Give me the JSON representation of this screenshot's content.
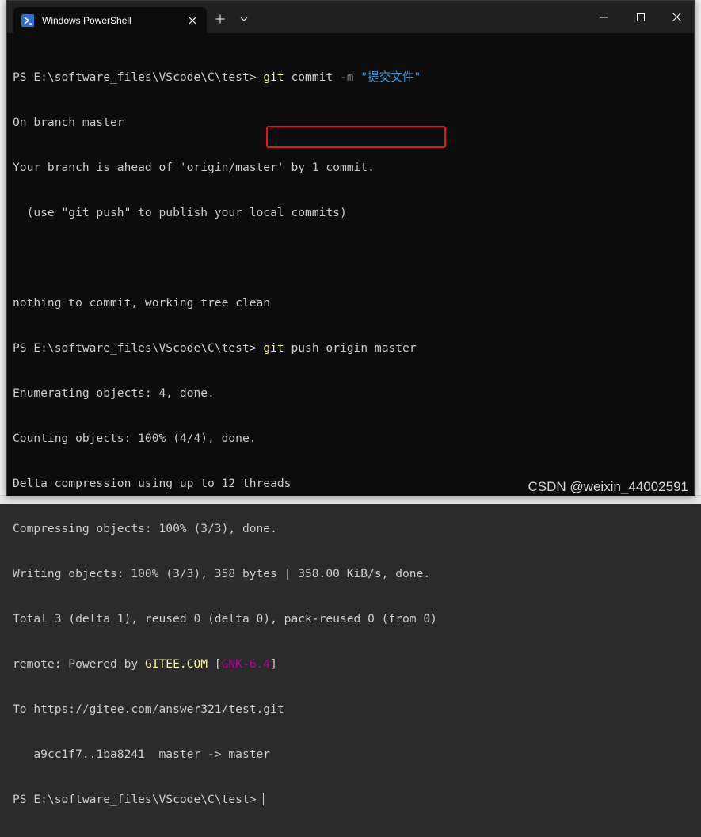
{
  "window": {
    "tab_title": "Windows PowerShell",
    "new_tab_symbol": "+",
    "icon": "powershell-icon"
  },
  "terminal": {
    "prompt": "PS E:\\software_files\\VScode\\C\\test>",
    "line1": {
      "cmd": "git",
      "mid": " commit ",
      "flag": "-m",
      "space": " ",
      "str": "\"提交文件\""
    },
    "line2": "On branch master",
    "line3": "Your branch is ahead of 'origin/master' by 1 commit.",
    "line4": "  (use \"git push\" to publish your local commits)",
    "line5": "",
    "line6": "nothing to commit, working tree clean",
    "line7": {
      "cmd": "git",
      "rest": " push origin master"
    },
    "line8": "Enumerating objects: 4, done.",
    "line9": "Counting objects: 100% (4/4), done.",
    "line10": "Delta compression using up to 12 threads",
    "line11": "Compressing objects: 100% (3/3), done.",
    "line12": "Writing objects: 100% (3/3), 358 bytes | 358.00 KiB/s, done.",
    "line13": "Total 3 (delta 1), reused 0 (delta 0), pack-reused 0 (from 0)",
    "line14": {
      "prefix": "remote: Powered by ",
      "gitee": "GITEE.COM",
      "open": " [",
      "gnk": "GNK-6.4",
      "close": "]"
    },
    "line15": "To https://gitee.com/answer321/test.git",
    "line16": "   a9cc1f7..1ba8241  master -> master"
  },
  "watermark": "CSDN @weixin_44002591",
  "colors": {
    "background": "#0c0c0c",
    "text": "#cccccc",
    "command": "#f9f1a5",
    "string": "#3a96dd",
    "flag": "#767676",
    "magenta": "#b4009e",
    "highlight": "#e01818"
  }
}
